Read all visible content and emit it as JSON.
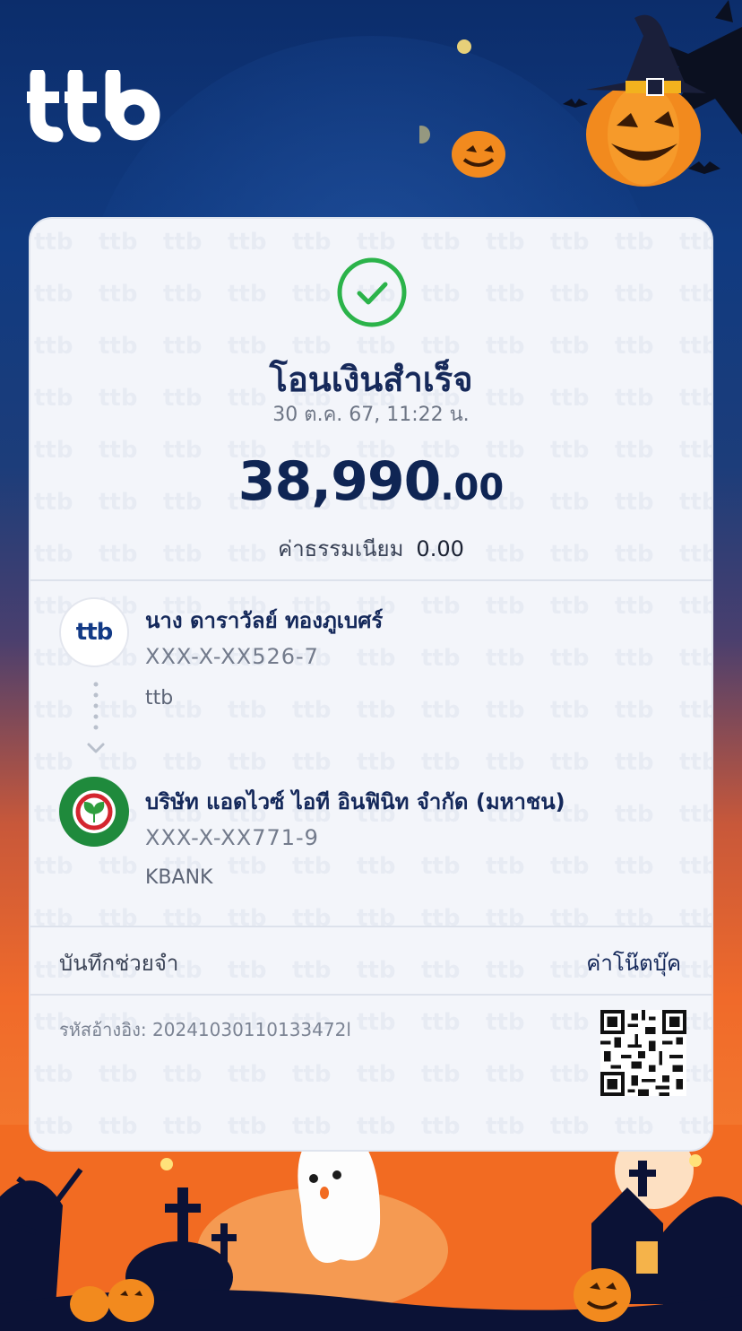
{
  "brand": {
    "logo_text": "ttb"
  },
  "receipt": {
    "status_title": "โอนเงินสำเร็จ",
    "datetime": "30 ต.ค. 67, 11:22 น.",
    "amount_int": "38,990",
    "amount_dec": ".00",
    "fee_label": "ค่าธรรมเนียม",
    "fee_value": "0.00"
  },
  "sender": {
    "name": "นาง ดาราวัลย์ ทองภูเบศร์",
    "account": "XXX-X-XX526-7",
    "bank": "ttb",
    "logo_text": "ttb"
  },
  "receiver": {
    "name": "บริษัท แอดไวซ์ ไอที อินฟินิท จำกัด (มหาชน)",
    "account": "XXX-X-XX771-9",
    "bank": "KBANK"
  },
  "memo": {
    "label": "บันทึกช่วยจำ",
    "link": "ค่าโน๊ตบุ๊ค"
  },
  "reference": {
    "text": "รหัสอ้างอิง: 20241030110133472l"
  },
  "colors": {
    "navy": "#14285a",
    "success": "#2bb34a",
    "orange": "#f26b22"
  }
}
